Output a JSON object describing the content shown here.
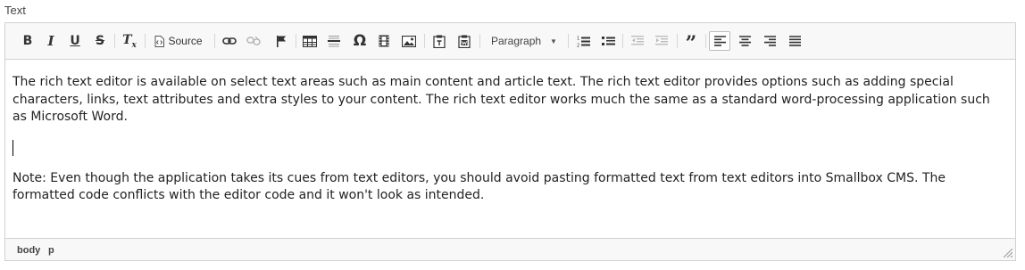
{
  "field": {
    "label": "Text"
  },
  "toolbar": {
    "source_label": "Source",
    "format_value": "Paragraph"
  },
  "content": {
    "paragraphs": [
      "The rich text editor is available on select text areas such as main content and article text. The rich text editor provides options such as adding special characters, links, text attributes and extra styles to your content. The rich text editor works much the same as a standard word-processing application such as Microsoft Word.",
      "Note: Even though the application takes its cues from text editors, you should avoid pasting formatted text from text editors into Smallbox CMS. The formatted code conflicts with the editor code and it won't look as intended."
    ]
  },
  "statusbar": {
    "path": [
      "body",
      "p"
    ]
  },
  "icons": {
    "special_char": "Ω",
    "quote": "”",
    "format_arrow": "▼"
  }
}
